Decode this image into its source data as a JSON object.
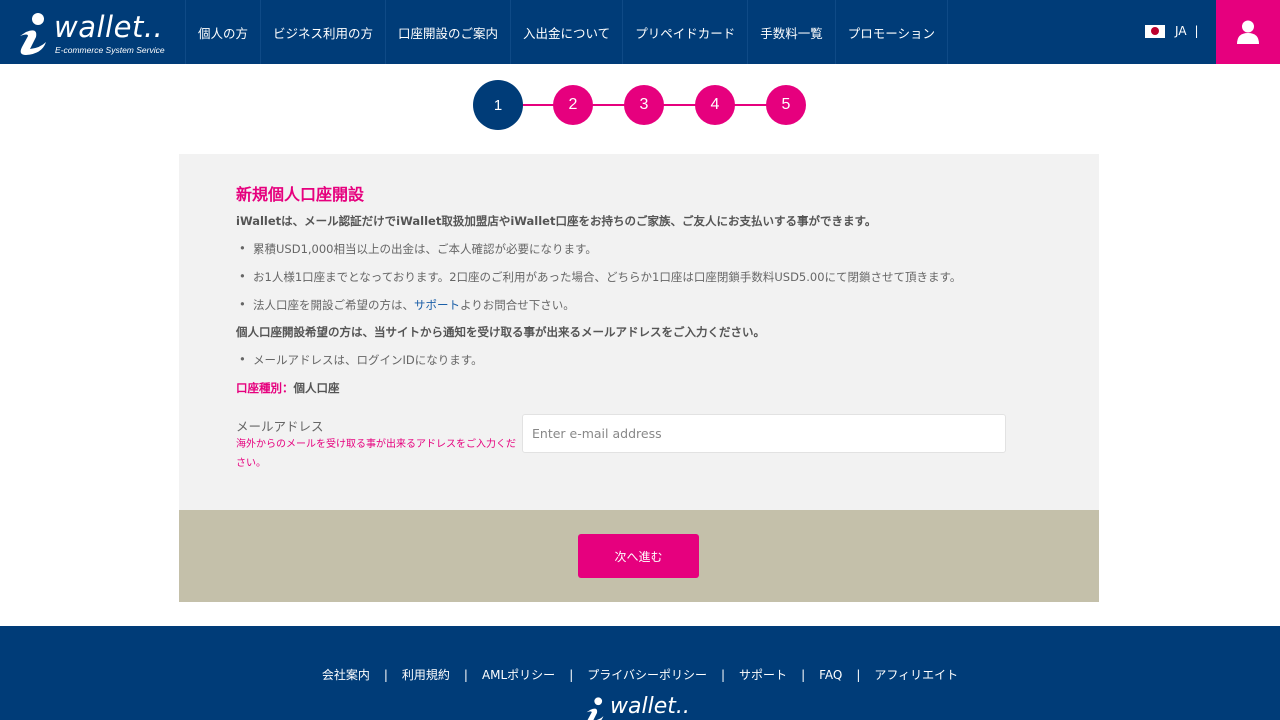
{
  "header": {
    "logo_text": "wallet..",
    "logo_sub": "E-commerce System Service",
    "nav": [
      {
        "label": "個人の方"
      },
      {
        "label": "ビジネス利用の方"
      },
      {
        "label": "口座開設のご案内"
      },
      {
        "label": "入出金について"
      },
      {
        "label": "プリペイドカード"
      },
      {
        "label": "手数料一覧"
      },
      {
        "label": "プロモーション"
      }
    ],
    "lang": "JA",
    "lang_sep": "|"
  },
  "steps": [
    "1",
    "2",
    "3",
    "4",
    "5"
  ],
  "current_step": 1,
  "form": {
    "title": "新規個人口座開設",
    "intro": "iWalletは、メール認証だけでiWallet取扱加盟店やiWallet口座をお持ちのご家族、ご友人にお支払いする事ができます。",
    "bullets": [
      "累積USD1,000相当以上の出金は、ご本人確認が必要になります。",
      "お1人様1口座までとなっております。2口座のご利用があった場合、どちらか1口座は口座閉鎖手数料USD5.00にて閉鎖させて頂きます。"
    ],
    "corp_bullet_prefix": "法人口座を開設ご希望の方は、",
    "corp_bullet_link": "サポート",
    "corp_bullet_suffix": "よりお問合せ下さい。",
    "email_lead": "個人口座開設希望の方は、当サイトから通知を受け取る事が出来るメールアドレスをご入力ください。",
    "email_bullet": "メールアドレスは、ログインIDになります。",
    "account_type_label": "口座種別：",
    "account_type_value": "個人口座",
    "email_label": "メールアドレス",
    "email_note": "海外からのメールを受け取る事が出来るアドレスをご入力ください。",
    "email_placeholder": "Enter e-mail address",
    "email_value": "",
    "next_label": "次へ進む"
  },
  "footer": {
    "links": [
      "会社案内",
      "利用規約",
      "AMLポリシー",
      "プライバシーポリシー",
      "サポート",
      "FAQ",
      "アフィリエイト"
    ],
    "separator": "|",
    "logo_text": "wallet.."
  },
  "colors": {
    "navy": "#003c78",
    "pink": "#e6007e",
    "panel": "#f2f2f2",
    "band": "#c4c0aa"
  }
}
